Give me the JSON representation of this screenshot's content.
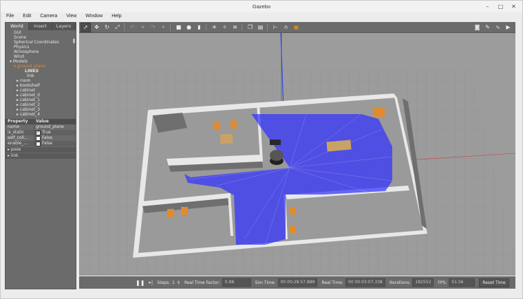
{
  "window": {
    "title": "Gazebo",
    "minimize": "–",
    "maximize": "□",
    "close": "✕"
  },
  "menu": [
    "File",
    "Edit",
    "Camera",
    "View",
    "Window",
    "Help"
  ],
  "left_tabs": [
    "World",
    "Insert",
    "Layers"
  ],
  "tree": {
    "gui": "GUI",
    "scene": "Scene",
    "spherical": "Spherical Coordinates",
    "physics": "Physics",
    "atmosphere": "Atmosphere",
    "wind": "Wind",
    "models": "Models",
    "ground_plane": "ground_plane",
    "links": "LINKS",
    "link": "link",
    "room": "room",
    "bookshelf": "bookshelf",
    "cabinet": "cabinet",
    "cabinet_0": "cabinet_0",
    "cabinet_1": "cabinet_1",
    "cabinet_2": "cabinet_2",
    "cabinet_3": "cabinet_3",
    "cabinet_4": "cabinet_4"
  },
  "props": {
    "header_property": "Property",
    "header_value": "Value",
    "name_label": "name",
    "name_value": "ground_plane",
    "is_static_label": "is_static",
    "is_static_value": "True",
    "self_col_label": "self_coll...",
    "self_col_value": "False",
    "enable_label": "enable_...",
    "enable_value": "False",
    "pose": "pose",
    "link": "link"
  },
  "status": {
    "steps_label": "Steps:",
    "steps_value": "1",
    "rtf_label": "Real Time Factor:",
    "rtf_value": "0.98",
    "sim_label": "Sim Time:",
    "sim_value": "00 00:28:57.889",
    "real_label": "Real Time:",
    "real_value": "00 00:03:07.338",
    "iter_label": "Iterations:",
    "iter_value": "182552",
    "fps_label": "FPS:",
    "fps_value": "51.56",
    "reset_label": "Reset Time"
  },
  "colors": {
    "laser": "#3232ff",
    "accent": "#e88a2c",
    "panel": "#6b6b6b"
  }
}
